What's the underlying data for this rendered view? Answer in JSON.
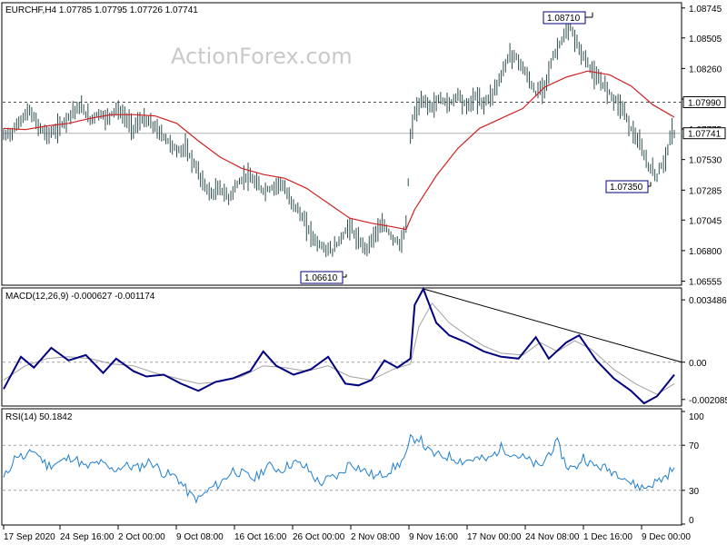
{
  "watermark": "ActionForex.com",
  "colors": {
    "candle": "#2f4f4f",
    "ma": "#d02020",
    "macd": "#000080",
    "signal": "#a0a0a0",
    "rsi": "#1e7fd0",
    "trendline": "#000000",
    "callout_border": "#000080",
    "grid_dash": "#a0a0a0"
  },
  "chart_data": [
    {
      "type": "candlestick",
      "title": "EURCHF,H4  1.07785 1.07795 1.07726 1.07741",
      "x_ticks": [
        "17 Sep 2020",
        "24 Sep 16:00",
        "2 Oct 00:00",
        "9 Oct 08:00",
        "16 Oct 16:00",
        "26 Oct 00:00",
        "2 Nov 08:00",
        "9 Nov 16:00",
        "17 Nov 00:00",
        "24 Nov 08:00",
        "1 Dec 16:00",
        "9 Dec 00:00"
      ],
      "y_ticks": [
        "1.08745",
        "1.08505",
        "1.08260",
        "1.08015",
        "1.07775",
        "1.07530",
        "1.07285",
        "1.07045",
        "1.06800",
        "1.06555"
      ],
      "ylim": [
        1.0653,
        1.0878
      ],
      "current_price_label": "1.07741",
      "current_price": 1.07741,
      "level_label": "1.07990",
      "level": 1.0799,
      "callouts": [
        {
          "label": "1.08710",
          "value": 1.0871
        },
        {
          "label": "1.06610",
          "value": 1.0661
        },
        {
          "label": "1.07350",
          "value": 1.0735
        }
      ],
      "close_path": [
        [
          0,
          1.0772
        ],
        [
          4,
          1.0775
        ],
        [
          8,
          1.0785
        ],
        [
          12,
          1.0792
        ],
        [
          16,
          1.078
        ],
        [
          20,
          1.0773
        ],
        [
          24,
          1.0776
        ],
        [
          28,
          1.0783
        ],
        [
          32,
          1.0792
        ],
        [
          36,
          1.0795
        ],
        [
          40,
          1.0785
        ],
        [
          44,
          1.079
        ],
        [
          48,
          1.0786
        ],
        [
          52,
          1.0794
        ],
        [
          56,
          1.0787
        ],
        [
          60,
          1.0778
        ],
        [
          64,
          1.0785
        ],
        [
          68,
          1.0782
        ],
        [
          72,
          1.0775
        ],
        [
          76,
          1.0768
        ],
        [
          80,
          1.076
        ],
        [
          84,
          1.0762
        ],
        [
          88,
          1.075
        ],
        [
          92,
          1.0735
        ],
        [
          96,
          1.0725
        ],
        [
          100,
          1.073
        ],
        [
          104,
          1.0722
        ],
        [
          108,
          1.0733
        ],
        [
          112,
          1.074
        ],
        [
          116,
          1.0735
        ],
        [
          120,
          1.0728
        ],
        [
          124,
          1.073
        ],
        [
          128,
          1.0735
        ],
        [
          132,
          1.0722
        ],
        [
          136,
          1.0713
        ],
        [
          140,
          1.07
        ],
        [
          144,
          1.0688
        ],
        [
          148,
          1.0682
        ],
        [
          152,
          1.068
        ],
        [
          156,
          1.069
        ],
        [
          160,
          1.07
        ],
        [
          164,
          1.0687
        ],
        [
          168,
          1.0682
        ],
        [
          172,
          1.0695
        ],
        [
          176,
          1.07
        ],
        [
          180,
          1.069
        ],
        [
          184,
          1.0685
        ],
        [
          186,
          1.07
        ],
        [
          188,
          1.077
        ],
        [
          190,
          1.079
        ],
        [
          194,
          1.08
        ],
        [
          198,
          1.0795
        ],
        [
          202,
          1.0802
        ],
        [
          206,
          1.0797
        ],
        [
          210,
          1.0806
        ],
        [
          214,
          1.0795
        ],
        [
          218,
          1.0803
        ],
        [
          222,
          1.0798
        ],
        [
          226,
          1.0806
        ],
        [
          230,
          1.082
        ],
        [
          234,
          1.0838
        ],
        [
          238,
          1.0833
        ],
        [
          242,
          1.082
        ],
        [
          246,
          1.0806
        ],
        [
          250,
          1.0812
        ],
        [
          254,
          1.0835
        ],
        [
          258,
          1.0849
        ],
        [
          262,
          1.0858
        ],
        [
          266,
          1.0842
        ],
        [
          270,
          1.083
        ],
        [
          274,
          1.0818
        ],
        [
          278,
          1.0812
        ],
        [
          282,
          1.0802
        ],
        [
          286,
          1.0795
        ],
        [
          290,
          1.0778
        ],
        [
          294,
          1.0765
        ],
        [
          298,
          1.0748
        ],
        [
          302,
          1.074
        ],
        [
          306,
          1.0755
        ],
        [
          309,
          1.0775
        ],
        [
          310,
          1.0774
        ]
      ],
      "ma_path": [
        [
          0,
          1.0778
        ],
        [
          10,
          1.0777
        ],
        [
          20,
          1.078
        ],
        [
          30,
          1.0782
        ],
        [
          40,
          1.0786
        ],
        [
          50,
          1.0789
        ],
        [
          60,
          1.0789
        ],
        [
          70,
          1.0788
        ],
        [
          80,
          1.0782
        ],
        [
          90,
          1.0768
        ],
        [
          100,
          1.0755
        ],
        [
          110,
          1.0746
        ],
        [
          120,
          1.0741
        ],
        [
          130,
          1.0738
        ],
        [
          140,
          1.073
        ],
        [
          150,
          1.0718
        ],
        [
          160,
          1.0706
        ],
        [
          170,
          1.0702
        ],
        [
          180,
          1.0699
        ],
        [
          186,
          1.0697
        ],
        [
          190,
          1.0713
        ],
        [
          200,
          1.074
        ],
        [
          210,
          1.0762
        ],
        [
          220,
          1.0778
        ],
        [
          230,
          1.0786
        ],
        [
          240,
          1.0794
        ],
        [
          250,
          1.0811
        ],
        [
          260,
          1.0819
        ],
        [
          270,
          1.0824
        ],
        [
          280,
          1.0821
        ],
        [
          290,
          1.0812
        ],
        [
          300,
          1.0797
        ],
        [
          310,
          1.0787
        ]
      ]
    },
    {
      "type": "line",
      "title": "MACD(12,26,9) -0.000627 -0.001174",
      "y_ticks": [
        "0.003486",
        "0.00",
        "-0.002085"
      ],
      "ylim": [
        -0.0024,
        0.004
      ],
      "series": [
        {
          "name": "MACD",
          "values": [
            [
              0,
              -0.0015
            ],
            [
              8,
              0.0003
            ],
            [
              14,
              -0.0003
            ],
            [
              22,
              0.0008
            ],
            [
              30,
              0.0001
            ],
            [
              38,
              0.0004
            ],
            [
              46,
              -0.0006
            ],
            [
              52,
              0.0002
            ],
            [
              60,
              -0.0005
            ],
            [
              66,
              -0.0008
            ],
            [
              74,
              -0.0007
            ],
            [
              82,
              -0.0012
            ],
            [
              90,
              -0.0016
            ],
            [
              98,
              -0.0011
            ],
            [
              106,
              -0.0009
            ],
            [
              114,
              -0.0005
            ],
            [
              120,
              0.0006
            ],
            [
              126,
              -0.0002
            ],
            [
              134,
              -0.0007
            ],
            [
              142,
              -0.0004
            ],
            [
              150,
              0.0003
            ],
            [
              158,
              -0.0012
            ],
            [
              164,
              -0.0013
            ],
            [
              170,
              -0.001
            ],
            [
              176,
              0.0001
            ],
            [
              182,
              -0.0003
            ],
            [
              188,
              0.0002
            ],
            [
              190,
              0.0032
            ],
            [
              194,
              0.0041
            ],
            [
              200,
              0.0022
            ],
            [
              206,
              0.0015
            ],
            [
              214,
              0.0011
            ],
            [
              222,
              0.0006
            ],
            [
              230,
              0.0003
            ],
            [
              238,
              0.0002
            ],
            [
              246,
              0.0014
            ],
            [
              252,
              0.0002
            ],
            [
              260,
              0.0011
            ],
            [
              266,
              0.0015
            ],
            [
              274,
              0.0001
            ],
            [
              282,
              -0.0009
            ],
            [
              290,
              -0.0016
            ],
            [
              296,
              -0.0023
            ],
            [
              302,
              -0.0019
            ],
            [
              310,
              -0.0007
            ]
          ]
        },
        {
          "name": "Signal",
          "values": [
            [
              0,
              -0.001
            ],
            [
              10,
              -0.0002
            ],
            [
              20,
              0.0002
            ],
            [
              30,
              0.0003
            ],
            [
              40,
              0.0002
            ],
            [
              50,
              -0.0001
            ],
            [
              60,
              -0.0002
            ],
            [
              70,
              -0.0006
            ],
            [
              80,
              -0.0009
            ],
            [
              90,
              -0.0012
            ],
            [
              100,
              -0.0011
            ],
            [
              110,
              -0.0008
            ],
            [
              120,
              -0.0002
            ],
            [
              130,
              -0.0003
            ],
            [
              140,
              -0.0005
            ],
            [
              150,
              -0.0002
            ],
            [
              160,
              -0.0008
            ],
            [
              170,
              -0.001
            ],
            [
              180,
              -0.0004
            ],
            [
              188,
              -0.0001
            ],
            [
              192,
              0.002
            ],
            [
              198,
              0.0033
            ],
            [
              206,
              0.0022
            ],
            [
              214,
              0.0015
            ],
            [
              222,
              0.0009
            ],
            [
              230,
              0.0005
            ],
            [
              240,
              0.0004
            ],
            [
              248,
              0.0011
            ],
            [
              256,
              0.0006
            ],
            [
              264,
              0.0012
            ],
            [
              272,
              0.0007
            ],
            [
              282,
              -0.0004
            ],
            [
              292,
              -0.0012
            ],
            [
              302,
              -0.0018
            ],
            [
              310,
              -0.0012
            ]
          ]
        }
      ],
      "trendline": [
        [
          194,
          0.0041
        ],
        [
          320,
          0.0
        ]
      ]
    },
    {
      "type": "line",
      "title": "RSI(14) 50.1842",
      "y_ticks": [
        "100",
        "70",
        "30",
        "0"
      ],
      "ylim": [
        0,
        100
      ],
      "levels": [
        70,
        30
      ],
      "series": [
        {
          "name": "RSI",
          "values": [
            [
              0,
              40
            ],
            [
              6,
              62
            ],
            [
              10,
              58
            ],
            [
              14,
              66
            ],
            [
              20,
              52
            ],
            [
              26,
              55
            ],
            [
              32,
              60
            ],
            [
              38,
              50
            ],
            [
              44,
              55
            ],
            [
              50,
              48
            ],
            [
              56,
              52
            ],
            [
              62,
              50
            ],
            [
              68,
              56
            ],
            [
              74,
              45
            ],
            [
              80,
              42
            ],
            [
              86,
              26
            ],
            [
              90,
              22
            ],
            [
              96,
              32
            ],
            [
              100,
              36
            ],
            [
              106,
              48
            ],
            [
              110,
              45
            ],
            [
              116,
              40
            ],
            [
              122,
              52
            ],
            [
              128,
              48
            ],
            [
              134,
              55
            ],
            [
              140,
              50
            ],
            [
              146,
              36
            ],
            [
              150,
              40
            ],
            [
              156,
              44
            ],
            [
              160,
              55
            ],
            [
              166,
              48
            ],
            [
              172,
              42
            ],
            [
              176,
              45
            ],
            [
              182,
              52
            ],
            [
              186,
              60
            ],
            [
              188,
              75
            ],
            [
              192,
              77
            ],
            [
              196,
              65
            ],
            [
              200,
              61
            ],
            [
              206,
              60
            ],
            [
              212,
              56
            ],
            [
              218,
              58
            ],
            [
              224,
              57
            ],
            [
              230,
              68
            ],
            [
              236,
              62
            ],
            [
              240,
              59
            ],
            [
              244,
              55
            ],
            [
              248,
              50
            ],
            [
              252,
              63
            ],
            [
              256,
              72
            ],
            [
              260,
              52
            ],
            [
              264,
              49
            ],
            [
              268,
              60
            ],
            [
              272,
              52
            ],
            [
              276,
              51
            ],
            [
              280,
              48
            ],
            [
              286,
              44
            ],
            [
              290,
              36
            ],
            [
              296,
              32
            ],
            [
              300,
              36
            ],
            [
              306,
              42
            ],
            [
              310,
              51
            ]
          ]
        }
      ]
    }
  ]
}
